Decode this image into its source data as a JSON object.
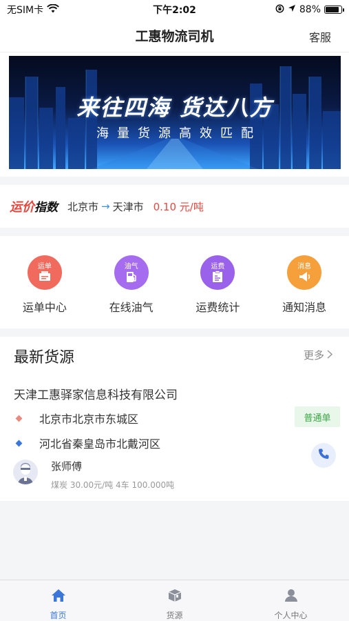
{
  "status_bar": {
    "carrier": "无SIM卡",
    "time": "下午2:02",
    "battery": "88%",
    "battery_level": 0.88
  },
  "nav": {
    "title": "工惠物流司机",
    "service": "客服"
  },
  "banner": {
    "headline": "来往四海 货达八方",
    "subline": "海量货源高效匹配"
  },
  "price_index": {
    "logo_red": "运价",
    "logo_black": "指数",
    "from": "北京市",
    "arrow": "→",
    "to": "天津市",
    "price": "0.10 元/吨"
  },
  "menu": [
    {
      "tag": "运单",
      "label": "运单中心",
      "color": "#f06b5e",
      "icon": "waybill-icon"
    },
    {
      "tag": "油气",
      "label": "在线油气",
      "color": "#a56cf0",
      "icon": "fuel-pump-icon"
    },
    {
      "tag": "运费",
      "label": "运费统计",
      "color": "#9a62ea",
      "icon": "freight-stats-icon"
    },
    {
      "tag": "消息",
      "label": "通知消息",
      "color": "#f5a03a",
      "icon": "megaphone-icon"
    }
  ],
  "cargo": {
    "title": "最新货源",
    "more": "更多",
    "item": {
      "company": "天津工惠驿家信息科技有限公司",
      "origin": "北京市北京市东城区",
      "destination": "河北省秦皇岛市北戴河区",
      "badge": "普通单",
      "driver": "张师傅",
      "detail": "煤炭 30.00元/吨 4车 100.000吨"
    }
  },
  "tabs": [
    {
      "label": "首页",
      "icon": "home-icon",
      "active": true
    },
    {
      "label": "货源",
      "icon": "cargo-box-icon",
      "active": false
    },
    {
      "label": "个人中心",
      "icon": "person-icon",
      "active": false
    }
  ],
  "colors": {
    "accent": "#3a77d8",
    "price_red": "#e8473e",
    "badge_green": "#3aa845"
  }
}
